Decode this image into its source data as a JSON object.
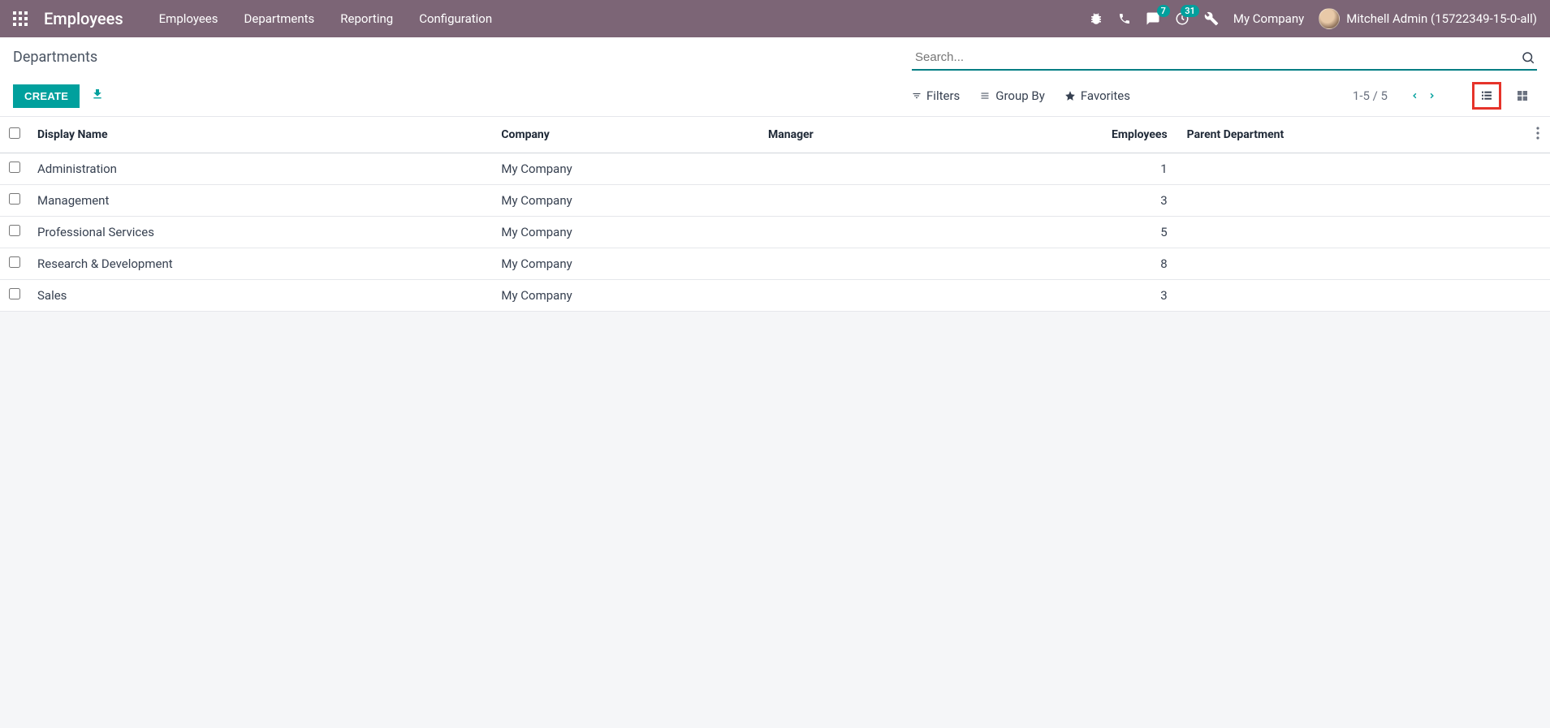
{
  "navbar": {
    "brand": "Employees",
    "menu": [
      "Employees",
      "Departments",
      "Reporting",
      "Configuration"
    ],
    "messaging_badge": "7",
    "activities_badge": "31",
    "company": "My Company",
    "user": "Mitchell Admin (15722349-15-0-all)"
  },
  "breadcrumb": "Departments",
  "search": {
    "placeholder": "Search..."
  },
  "buttons": {
    "create": "CREATE"
  },
  "search_options": {
    "filters": "Filters",
    "group_by": "Group By",
    "favorites": "Favorites"
  },
  "pager": "1-5 / 5",
  "table": {
    "headers": {
      "display_name": "Display Name",
      "company": "Company",
      "manager": "Manager",
      "employees": "Employees",
      "parent_department": "Parent Department"
    },
    "rows": [
      {
        "display_name": "Administration",
        "company": "My Company",
        "manager": "",
        "employees": "1",
        "parent_department": ""
      },
      {
        "display_name": "Management",
        "company": "My Company",
        "manager": "",
        "employees": "3",
        "parent_department": ""
      },
      {
        "display_name": "Professional Services",
        "company": "My Company",
        "manager": "",
        "employees": "5",
        "parent_department": ""
      },
      {
        "display_name": "Research & Development",
        "company": "My Company",
        "manager": "",
        "employees": "8",
        "parent_department": ""
      },
      {
        "display_name": "Sales",
        "company": "My Company",
        "manager": "",
        "employees": "3",
        "parent_department": ""
      }
    ]
  }
}
